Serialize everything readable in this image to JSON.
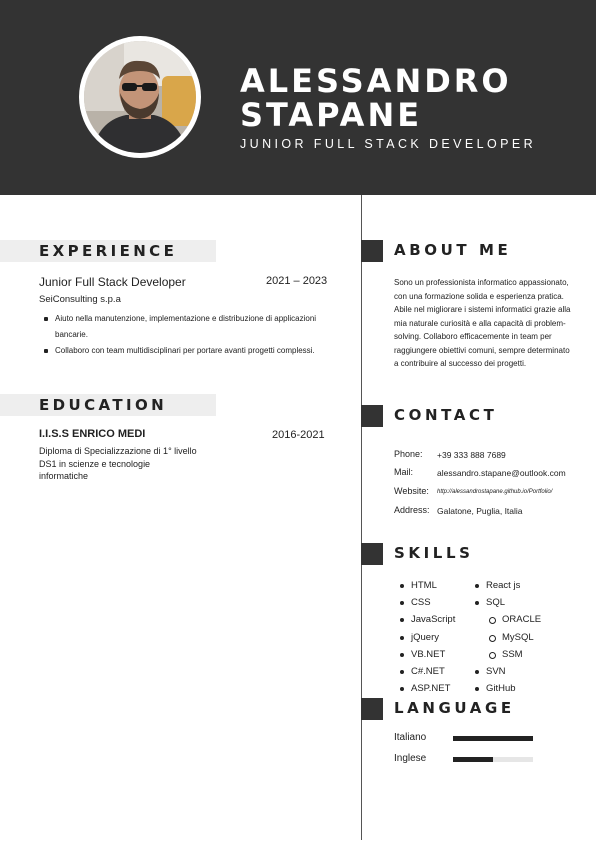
{
  "header": {
    "name_line1": "ALESSANDRO",
    "name_line2": "STAPANE",
    "title": "JUNIOR FULL STACK DEVELOPER"
  },
  "experience": {
    "heading": "EXPERIENCE",
    "job_title": "Junior Full Stack Developer",
    "years": "2021 – 2023",
    "company": "SeiConsulting s.p.a",
    "bullets": [
      "Aiuto nella manutenzione, implementazione e distribuzione di applicazioni bancarie.",
      "Collaboro con team multidisciplinari per portare avanti progetti complessi."
    ]
  },
  "education": {
    "heading": "EDUCATION",
    "school": "I.I.S.S ENRICO MEDI",
    "years": "2016-2021",
    "description": "Diploma di Specializzazione di 1° livello DS1 in scienze e tecnologie informatiche"
  },
  "about": {
    "heading": "ABOUT ME",
    "text": "Sono un professionista informatico appassionato, con una formazione solida e esperienza pratica. Abile nel migliorare i sistemi informatici grazie alla mia naturale curiosità e alla capacità di problem-solving. Collaboro efficacemente in team per raggiungere obiettivi comuni, sempre determinato a contribuire al successo dei progetti."
  },
  "contact": {
    "heading": "CONTACT",
    "phone_label": "Phone:",
    "phone": "+39 333 888 7689",
    "mail_label": "Mail:",
    "mail": "alessandro.stapane@outlook.com",
    "website_label": "Website:",
    "website": "http://alessandrostapane.github.io/Portfolio/",
    "address_label": "Address:",
    "address": "Galatone, Puglia, Italia"
  },
  "skills": {
    "heading": "SKILLS",
    "col1": [
      "HTML",
      "CSS",
      "JavaScript",
      "jQuery",
      "VB.NET",
      "C#.NET",
      "ASP.NET"
    ],
    "col2": [
      {
        "label": "React js",
        "sub": false
      },
      {
        "label": "SQL",
        "sub": false
      },
      {
        "label": "ORACLE",
        "sub": true
      },
      {
        "label": "MySQL",
        "sub": true
      },
      {
        "label": "SSM",
        "sub": true
      },
      {
        "label": "SVN",
        "sub": false
      },
      {
        "label": "GitHub",
        "sub": false
      }
    ]
  },
  "language": {
    "heading": "LANGUAGE",
    "items": [
      {
        "label": "Italiano",
        "level": 1.0
      },
      {
        "label": "Inglese",
        "level": 0.5
      }
    ]
  },
  "colors": {
    "header_bg": "#333333",
    "section_bg": "#eeeeee",
    "accent": "#222222"
  }
}
